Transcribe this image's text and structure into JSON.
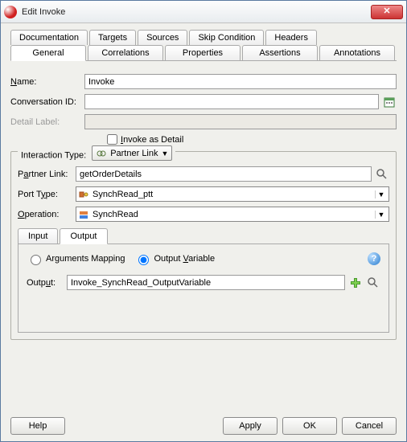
{
  "window": {
    "title": "Edit Invoke"
  },
  "tabs_row1": [
    "Documentation",
    "Targets",
    "Sources",
    "Skip Condition",
    "Headers"
  ],
  "tabs_row2": [
    "General",
    "Correlations",
    "Properties",
    "Assertions",
    "Annotations"
  ],
  "active_tab2": "General",
  "labels": {
    "name": "Name:",
    "conversation_id": "Conversation ID:",
    "detail_label": "Detail Label:",
    "invoke_as_detail": "Invoke as Detail",
    "interaction_type": "Interaction Type:",
    "partner_link": "Partner Link:",
    "port_type": "Port Type:",
    "operation": "Operation:",
    "output": "Output:"
  },
  "values": {
    "name": "Invoke",
    "conversation_id": "",
    "detail_label": "",
    "invoke_as_detail_checked": false,
    "interaction_type": "Partner Link",
    "partner_link": "getOrderDetails",
    "port_type": "SynchRead_ptt",
    "operation": "SynchRead",
    "output": "Invoke_SynchRead_OutputVariable"
  },
  "inner_tabs": {
    "items": [
      "Input",
      "Output"
    ],
    "active": "Output"
  },
  "output_panel": {
    "arguments_mapping": "Arguments Mapping",
    "output_variable": "Output Variable",
    "selected": "output_variable"
  },
  "buttons": {
    "help": "Help",
    "apply": "Apply",
    "ok": "OK",
    "cancel": "Cancel"
  }
}
